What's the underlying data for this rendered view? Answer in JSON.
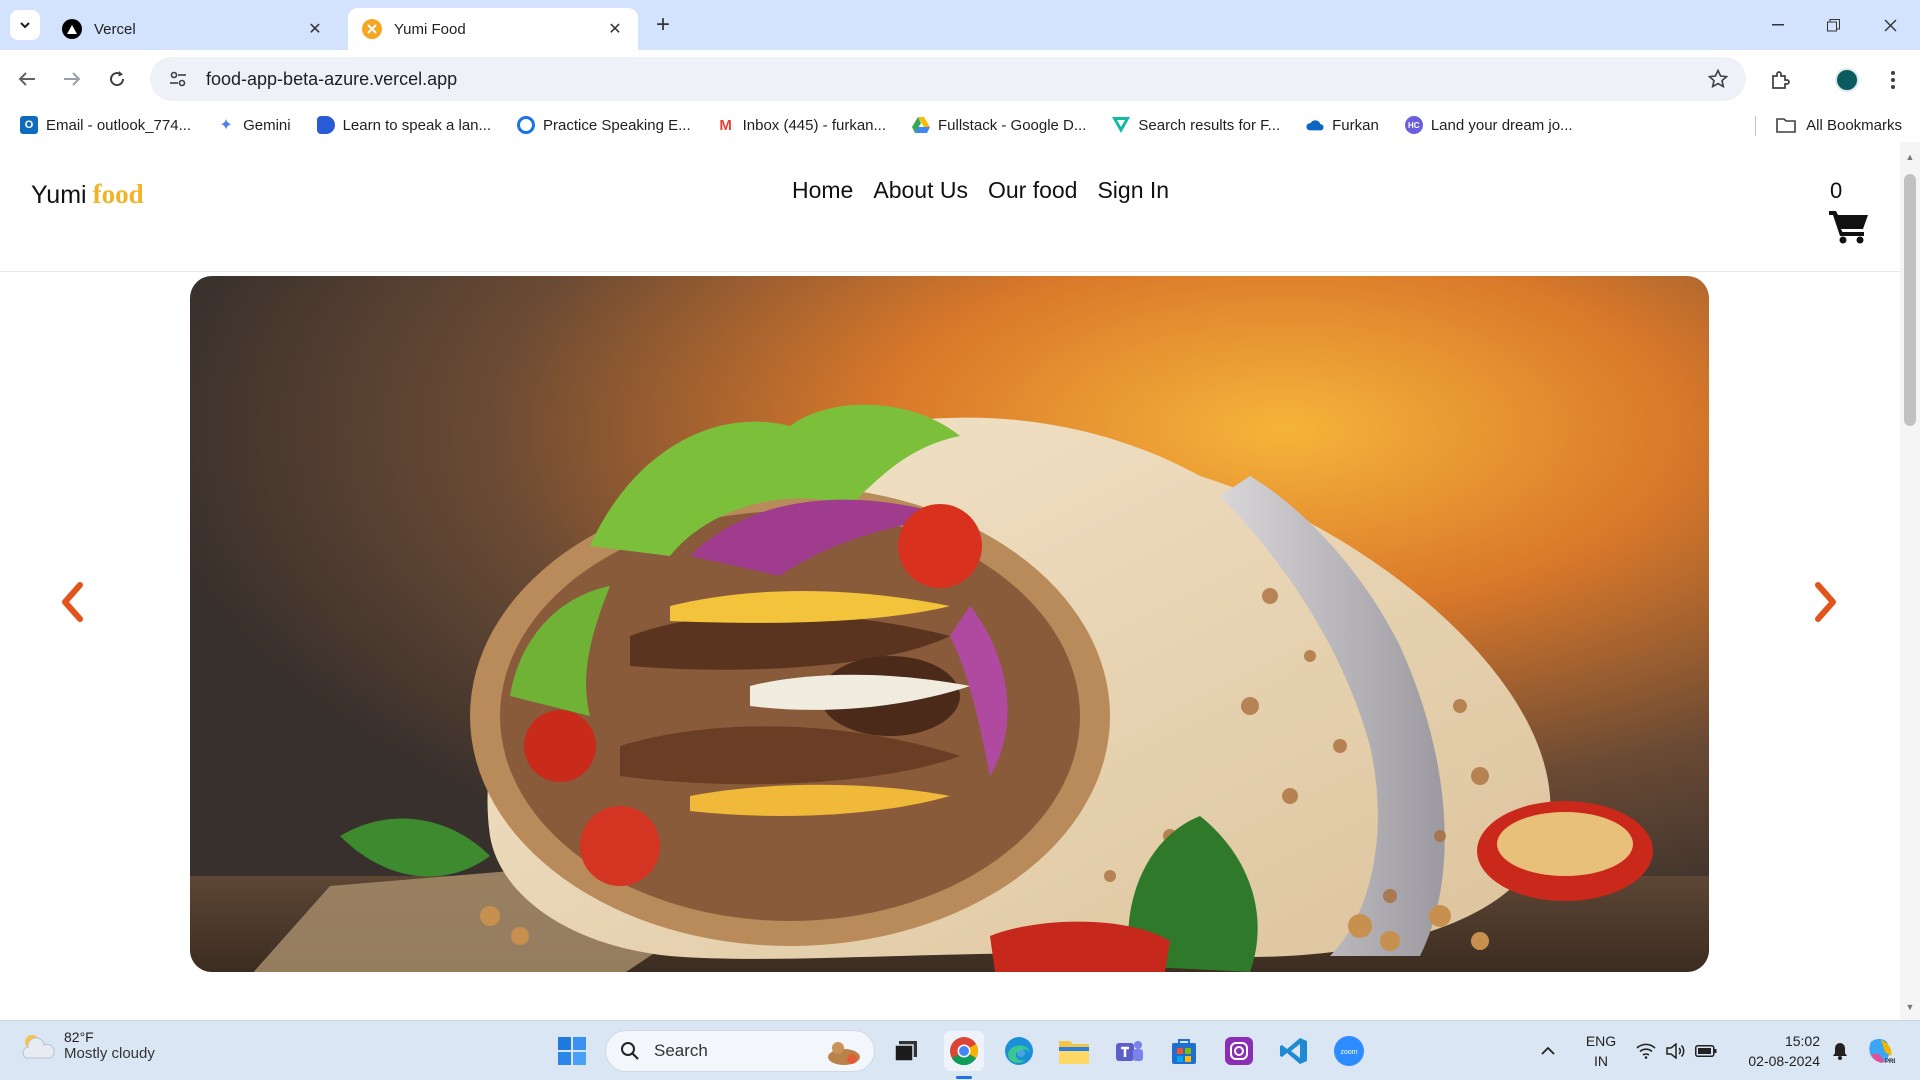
{
  "browser": {
    "tabs": [
      {
        "title": "Vercel",
        "favicon": "vercel-icon",
        "active": false
      },
      {
        "title": "Yumi Food",
        "favicon": "yumi-food-icon",
        "active": true
      }
    ],
    "url": "food-app-beta-azure.vercel.app",
    "bookmarks": [
      {
        "label": "Email - outlook_774...",
        "icon": "outlook-icon",
        "color": "#0f6cbd"
      },
      {
        "label": "Gemini",
        "icon": "gemini-icon",
        "color": "#4f7ff0"
      },
      {
        "label": "Learn to speak a lan...",
        "icon": "speak-icon",
        "color": "#2a5bd7"
      },
      {
        "label": "Practice Speaking E...",
        "icon": "practice-icon",
        "color": "#1a73e8"
      },
      {
        "label": "Inbox (445) - furkan...",
        "icon": "gmail-icon",
        "color": "#ea4335"
      },
      {
        "label": "Fullstack - Google D...",
        "icon": "google-drive-icon",
        "color": "#34a853"
      },
      {
        "label": "Search results for F...",
        "icon": "search-results-icon",
        "color": "#14b8a6"
      },
      {
        "label": "Furkan",
        "icon": "onedrive-icon",
        "color": "#0a66c2"
      },
      {
        "label": "Land your dream jo...",
        "icon": "job-site-icon",
        "color": "#6b5fe0"
      }
    ],
    "all_bookmarks": "All Bookmarks"
  },
  "site": {
    "logo_text": "Yumi",
    "logo_accent": "food",
    "nav": [
      "Home",
      "About Us",
      "Our food",
      "Sign In"
    ],
    "cart_count": "0",
    "colors": {
      "accent": "#f0b429",
      "arrow": "#e2541b"
    }
  },
  "taskbar": {
    "weather_temp": "82°F",
    "weather_condition": "Mostly cloudy",
    "search_label": "Search",
    "lang_primary": "ENG",
    "lang_secondary": "IN",
    "time": "15:02",
    "date": "02-08-2024",
    "apps": [
      "start-icon",
      "task-view-icon",
      "chrome-icon",
      "edge-icon",
      "file-explorer-icon",
      "teams-icon",
      "store-icon",
      "instagram-icon",
      "vscode-icon",
      "zoom-icon"
    ]
  }
}
